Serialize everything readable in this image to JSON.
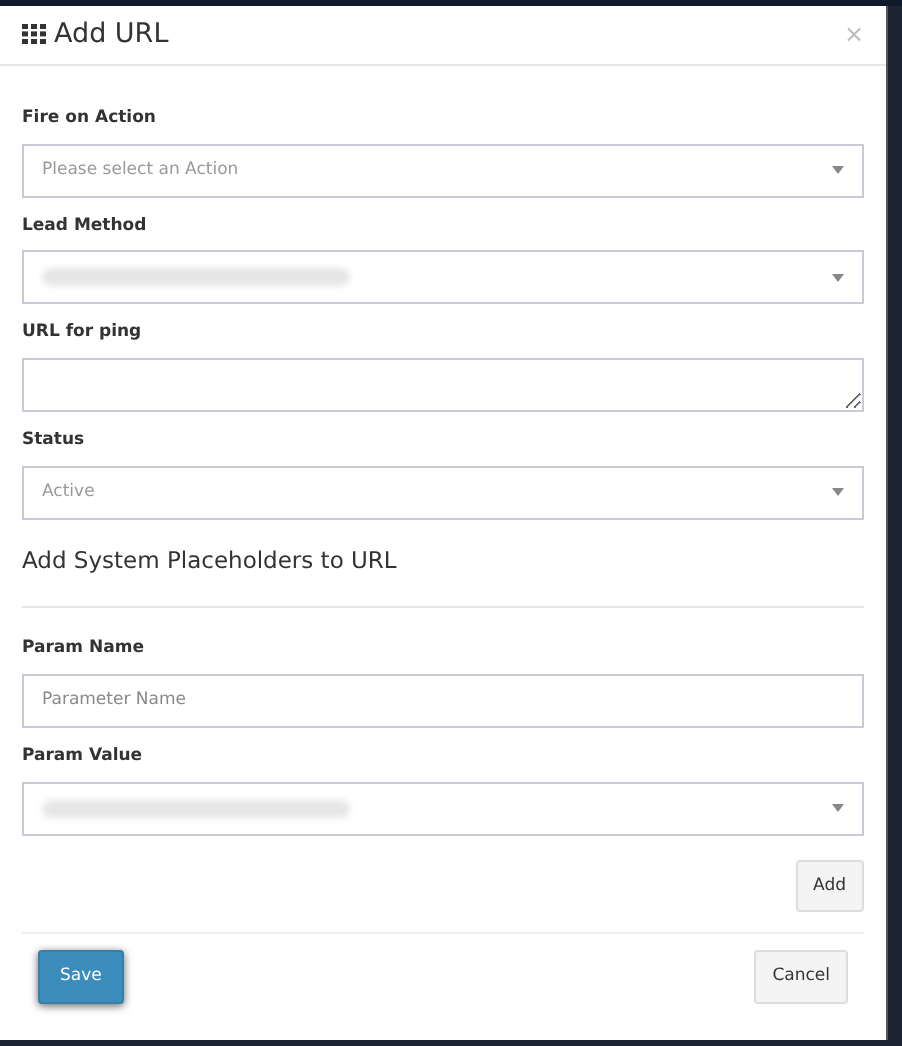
{
  "modal": {
    "title": "Add URL",
    "close": "×"
  },
  "fields": [
    {
      "kind": "select",
      "label": "Fire on Action",
      "value": "Please select an Action"
    },
    {
      "kind": "select",
      "label": "Lead Method",
      "redacted": true
    },
    {
      "kind": "textarea",
      "label": "URL for ping"
    },
    {
      "kind": "select",
      "label": "Status",
      "value": "Active"
    }
  ],
  "section_title": "Add System Placeholders to URL",
  "param_fields": [
    {
      "kind": "input",
      "label": "Param Name",
      "placeholder": "Parameter Name"
    },
    {
      "kind": "select",
      "label": "Param Value",
      "redacted": true
    }
  ],
  "add_button": "Add",
  "footer": {
    "save": "Save",
    "cancel": "Cancel"
  }
}
